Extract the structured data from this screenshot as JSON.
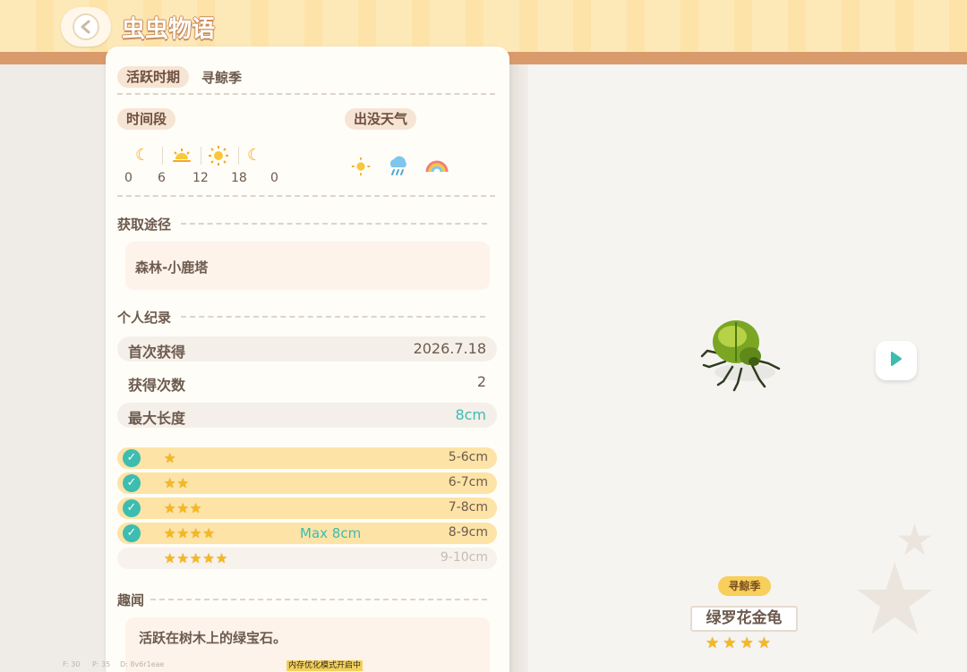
{
  "header": {
    "title": "虫虫物语"
  },
  "active_period": {
    "label": "活跃时期",
    "value": "寻鲸季"
  },
  "time_section": {
    "label": "时间段",
    "icons": [
      "moon-icon",
      "sunrise-icon",
      "sun-icon",
      "moon-icon"
    ],
    "hours": [
      "0",
      "6",
      "12",
      "18",
      "0"
    ]
  },
  "weather_section": {
    "label": "出没天气",
    "icons": [
      "sun-icon",
      "rain-cloud-icon",
      "rainbow-icon"
    ]
  },
  "source_section": {
    "label": "获取途径",
    "value": "森林-小鹿塔"
  },
  "record_section": {
    "label": "个人纪录",
    "rows": [
      {
        "label": "首次获得",
        "value": "2026.7.18"
      },
      {
        "label": "获得次数",
        "value": "2"
      },
      {
        "label": "最大长度",
        "value": "8cm"
      }
    ]
  },
  "size_tiers": [
    {
      "stars": "★",
      "range": "5-6cm",
      "checked": true
    },
    {
      "stars": "★★",
      "range": "6-7cm",
      "checked": true
    },
    {
      "stars": "★★★",
      "range": "7-8cm",
      "checked": true
    },
    {
      "stars": "★★★★",
      "range": "8-9cm",
      "checked": true,
      "tag": "Max 8cm"
    },
    {
      "stars": "★★★★★",
      "range": "9-10cm",
      "checked": false
    }
  ],
  "fun_section": {
    "label": "趣闻",
    "value": "活跃在树木上的绿宝石。"
  },
  "specimen": {
    "season_badge": "寻鲸季",
    "name": "绿罗花金龟",
    "stars": "★★★★"
  },
  "footer": {
    "stats": [
      "F: 30",
      "P: 35",
      "D: 8v6r1eae"
    ],
    "notice": "内存优化模式开启中"
  },
  "colors": {
    "accent_teal": "#3dbcb0",
    "star_gold": "#f5b820",
    "header_bg": "#fde3a8"
  }
}
